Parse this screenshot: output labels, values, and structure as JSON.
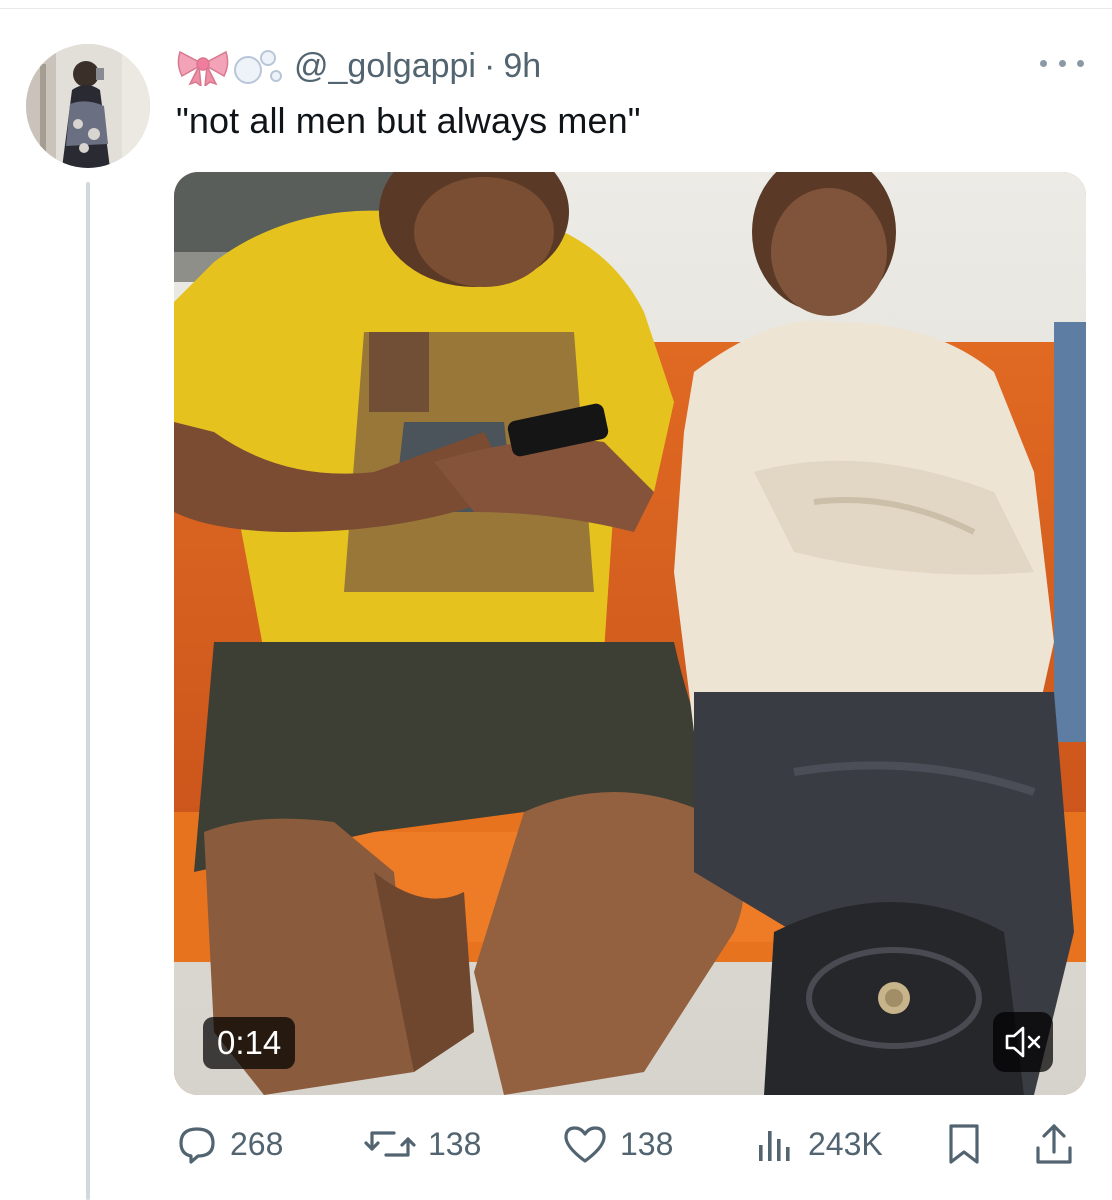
{
  "tweet": {
    "handle": "@_golgappi",
    "separator": "·",
    "time": "9h",
    "text": "\"not all men but always men\""
  },
  "media": {
    "duration": "0:14",
    "mute_icon": "speaker-muted-icon"
  },
  "actions": {
    "replies": "268",
    "reposts": "138",
    "likes": "138",
    "views": "243K"
  },
  "icons": {
    "reply": "reply-icon",
    "repost": "repost-icon",
    "like": "heart-icon",
    "views": "analytics-icon",
    "bookmark": "bookmark-icon",
    "share": "share-icon",
    "more": "more-options-icon"
  },
  "colors": {
    "text_primary": "#0f1419",
    "text_secondary": "#536471",
    "thread_line": "#cfd9de"
  }
}
